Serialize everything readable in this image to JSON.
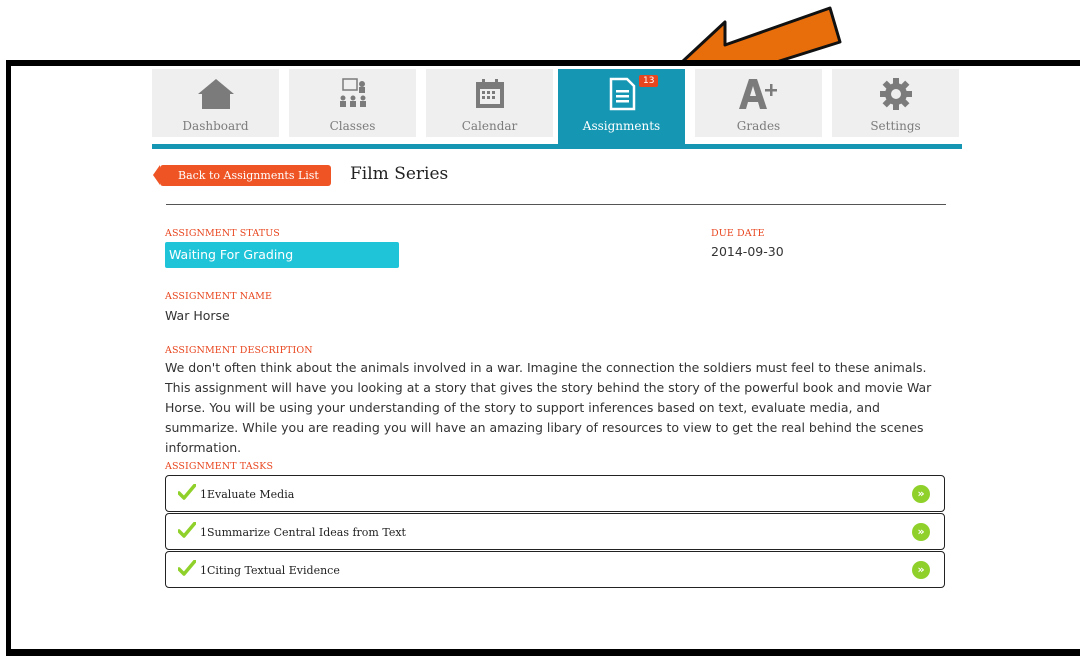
{
  "nav": {
    "tabs": [
      {
        "label": "Dashboard",
        "icon": "home-icon"
      },
      {
        "label": "Classes",
        "icon": "classroom-icon"
      },
      {
        "label": "Calendar",
        "icon": "calendar-icon"
      },
      {
        "label": "Assignments",
        "icon": "assignment-icon",
        "badge": "13",
        "active": true
      },
      {
        "label": "Grades",
        "icon": "grade-a-plus-icon"
      },
      {
        "label": "Settings",
        "icon": "gear-icon"
      }
    ]
  },
  "header": {
    "back_label": "Back to Assignments List",
    "title": "Film Series"
  },
  "status": {
    "label": "ASSIGNMENT STATUS",
    "value": "Waiting For Grading"
  },
  "due": {
    "label": "DUE DATE",
    "value": "2014-09-30"
  },
  "name": {
    "label": "ASSIGNMENT NAME",
    "value": "War Horse"
  },
  "description": {
    "label": "ASSIGNMENT DESCRIPTION",
    "text": "We don't often think about the animals involved in a war. Imagine the connection the soldiers must feel to these animals. This assignment will have you looking at a story that gives the story behind the story of the powerful book and movie War Horse. You will be using your understanding of the story to support inferences based on text, evaluate media, and summarize. While you are reading you will have an amazing libary of resources to view to get the real behind the scenes information."
  },
  "tasks": {
    "label": "ASSIGNMENT TASKS",
    "items": [
      {
        "title": "1Evaluate Media",
        "icon": "checkmark-icon",
        "action": "»"
      },
      {
        "title": "1Summarize Central Ideas from Text",
        "icon": "checkmark-icon",
        "action": "»"
      },
      {
        "title": "1Citing Textual Evidence",
        "icon": "checkmark-icon",
        "action": "»"
      }
    ]
  },
  "colors": {
    "accent": "#1597b3",
    "status": "#20c4d9",
    "label": "#e8461f",
    "arrow": "#e86e0c",
    "go": "#8fd12a"
  }
}
